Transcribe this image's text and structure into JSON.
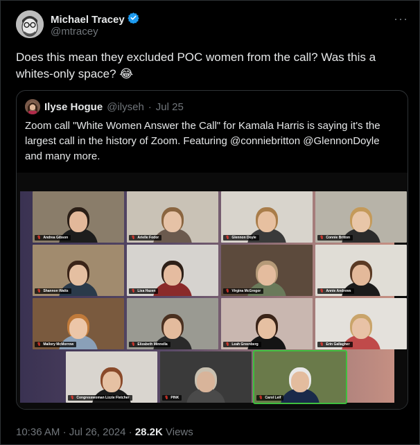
{
  "author": {
    "name": "Michael Tracey",
    "handle": "@mtracey",
    "verified": true,
    "avatar_icon": "cartoon-face-avatar"
  },
  "more_icon": "ellipsis-icon",
  "tweet": {
    "text_line1": "Does this mean they excluded POC women from the call? Was this a",
    "text_line2": "whites-only space? 😂"
  },
  "quote": {
    "name": "Ilyse Hogue",
    "handle": "@ilyseh",
    "separator": "·",
    "date": "Jul 25",
    "text": "Zoom call \"White Women Answer the Call\" for Kamala Harris is saying it's the largest call in the history of Zoom. Featuring @conniebritton @GlennonDoyle and many more."
  },
  "zoom_tiles": [
    {
      "label": "Andrea Gibson",
      "bg": "#8a7d6a",
      "skin": "#e2b89a",
      "hair": "#2a1e16",
      "shirt": "#1d1d1d"
    },
    {
      "label": "Arielle Fodor",
      "bg": "#c9c2b6",
      "skin": "#e6c2a6",
      "hair": "#8a6540",
      "shirt": "#6b5a4e"
    },
    {
      "label": "Glennon Doyle",
      "bg": "#d8d4cc",
      "skin": "#e7c0a0",
      "hair": "#a97d4a",
      "shirt": "#3a3a3a"
    },
    {
      "label": "Connie Britton",
      "bg": "#b7b3a8",
      "skin": "#e8c6a8",
      "hair": "#c49a5a",
      "shirt": "#2b2b2b"
    },
    {
      "label": "Shannon Watts",
      "bg": "#a18b6e",
      "skin": "#e5bfa1",
      "hair": "#3a2418",
      "shirt": "#2a3a4a"
    },
    {
      "label": "Lisa Hazen",
      "bg": "#d6d3cf",
      "skin": "#e5bca0",
      "hair": "#2d1f17",
      "shirt": "#8a2a2a"
    },
    {
      "label": "Virgina McGregor",
      "bg": "#5c4a3c",
      "skin": "#e4bc9e",
      "hair": "#b59a78",
      "shirt": "#6a7a5a"
    },
    {
      "label": "Annie Andrews",
      "bg": "#e0ddd6",
      "skin": "#e3b99a",
      "hair": "#5a3a24",
      "shirt": "#1b1b1b"
    },
    {
      "label": "Mallory McMorrow",
      "bg": "#7a5a3e",
      "skin": "#ecc6a8",
      "hair": "#c07a3a",
      "shirt": "#8aa0b8"
    },
    {
      "label": "Elizabeth Minnella",
      "bg": "#9a9a92",
      "skin": "#e3bb9d",
      "hair": "#4a3020",
      "shirt": "#2a2a2a"
    },
    {
      "label": "Leah Greenberg",
      "bg": "#c9b7b0",
      "skin": "#e6c0a2",
      "hair": "#3a2418",
      "shirt": "#141414"
    },
    {
      "label": "Erin Gallagher",
      "bg": "#e4e1dc",
      "skin": "#e8c2a6",
      "hair": "#c9a46a",
      "shirt": "#c04a4a"
    },
    {
      "label": "Congresswoman Lizzie Fletcher",
      "bg": "#d9d5cf",
      "skin": "#e6c1a3",
      "hair": "#8a4a2a",
      "shirt": "#1b1b1b"
    },
    {
      "label": "PINK",
      "bg": "#3a3a3a",
      "skin": "#d8b49a",
      "hair": "#c8c0b0",
      "shirt": "#4a4a4a"
    },
    {
      "label": "Carol Leif",
      "bg": "#6a7a4a",
      "skin": "#e3bc9e",
      "hair": "#e8e8e8",
      "shirt": "#1a2a4a"
    }
  ],
  "footer": {
    "time": "10:36 AM",
    "sep": "·",
    "date": "Jul 26, 2024",
    "views_count": "28.2K",
    "views_label": "Views"
  },
  "colors": {
    "background": "#000000",
    "text": "#e7e9ea",
    "secondary": "#71767b",
    "border": "#2f3336",
    "verified": "#1d9bf0"
  }
}
